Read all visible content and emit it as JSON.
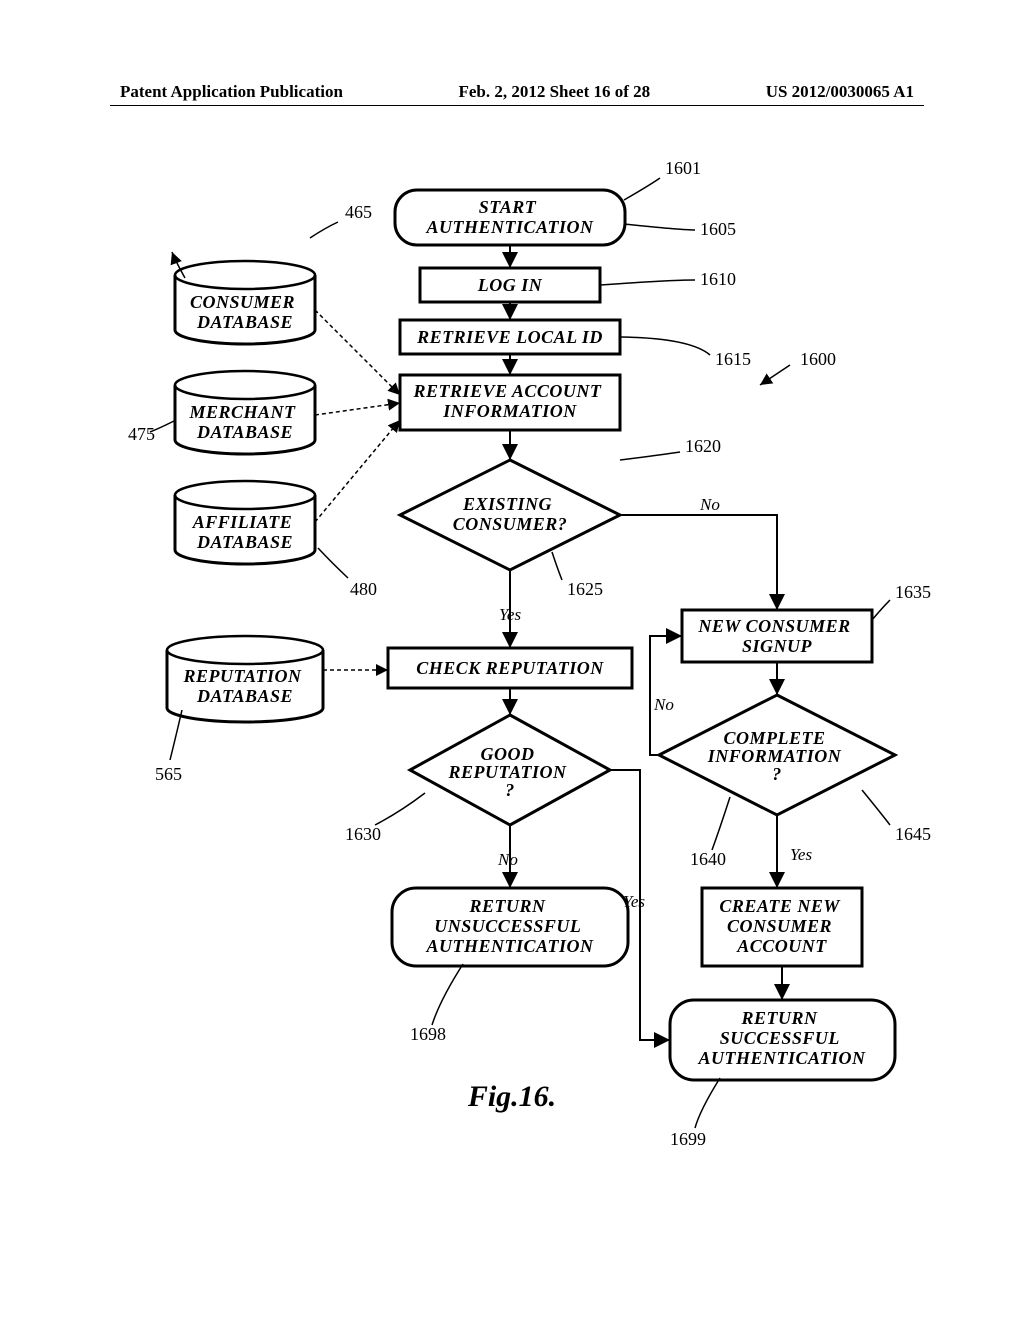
{
  "header": {
    "left": "Patent Application Publication",
    "middle": "Feb. 2, 2012  Sheet 16 of 28",
    "right": "US 2012/0030065 A1"
  },
  "figure_caption": "Fig.16.",
  "nodes": {
    "start": "START\nAUTHENTICATION",
    "login": "LOG IN",
    "retrieve_local": "RETRIEVE LOCAL ID",
    "retrieve_account": "RETRIEVE ACCOUNT\nINFORMATION",
    "existing_consumer": "EXISTING\nCONSUMER?",
    "check_reputation": "CHECK REPUTATION",
    "good_reputation": "GOOD\nREPUTATION\n?",
    "return_unsuccessful": "RETURN\nUNSUCCESSFUL\nAUTHENTICATION",
    "new_signup": "NEW CONSUMER\nSIGNUP",
    "complete_info": "COMPLETE\nINFORMATION\n?",
    "create_account": "CREATE NEW\nCONSUMER\nACCOUNT",
    "return_successful": "RETURN\nSUCCESSFUL\nAUTHENTICATION",
    "db_consumer": "CONSUMER\nDATABASE",
    "db_merchant": "MERCHANT\nDATABASE",
    "db_affiliate": "AFFILIATE\nDATABASE",
    "db_reputation": "REPUTATION\nDATABASE"
  },
  "edge_labels": {
    "yes1": "Yes",
    "no1": "No",
    "no2": "No",
    "no3": "No",
    "yes2": "Yes",
    "yes3": "Yes"
  },
  "refs": {
    "r465": "465",
    "r475": "475",
    "r480": "480",
    "r565": "565",
    "r1600": "1600",
    "r1601": "1601",
    "r1605": "1605",
    "r1610": "1610",
    "r1615": "1615",
    "r1620": "1620",
    "r1625": "1625",
    "r1630": "1630",
    "r1635": "1635",
    "r1640": "1640",
    "r1645": "1645",
    "r1698": "1698",
    "r1699": "1699"
  }
}
